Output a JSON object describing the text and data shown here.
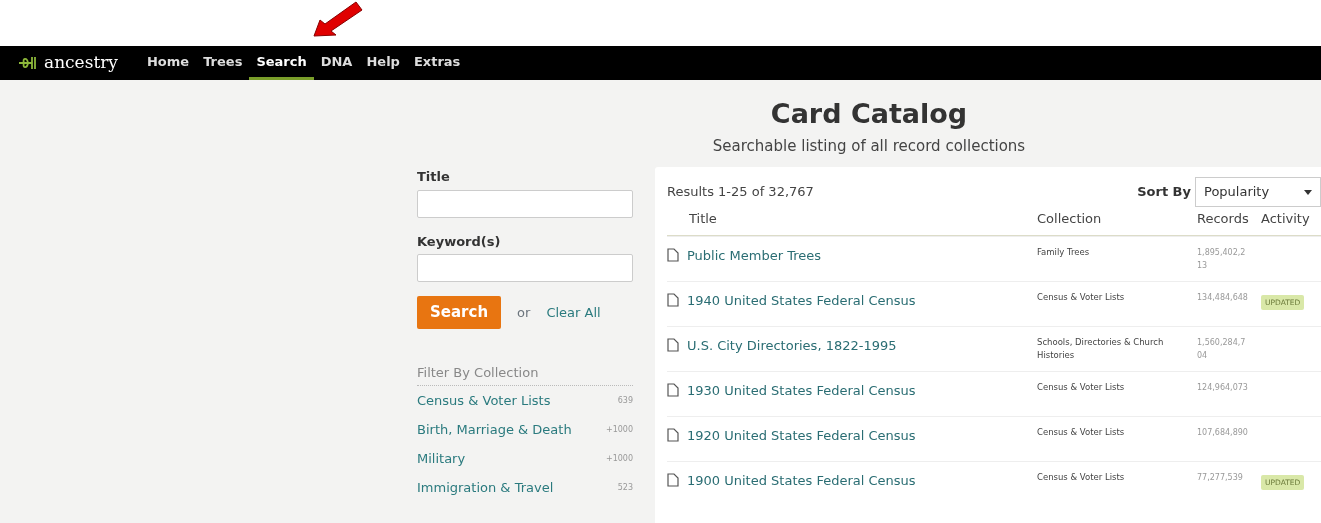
{
  "nav": {
    "logo": "ancestry",
    "items": [
      {
        "label": "Home",
        "selected": false
      },
      {
        "label": "Trees",
        "selected": false
      },
      {
        "label": "Search",
        "selected": true
      },
      {
        "label": "DNA",
        "selected": false
      },
      {
        "label": "Help",
        "selected": false
      },
      {
        "label": "Extras",
        "selected": false
      }
    ]
  },
  "heading": {
    "title": "Card Catalog",
    "subtitle": "Searchable listing of all record collections"
  },
  "form": {
    "fields": [
      {
        "label": "Title"
      },
      {
        "label": "Keyword(s)"
      }
    ],
    "search_button": "Search",
    "or": "or",
    "clear_link": "Clear All",
    "filter_title": "Filter By Collection",
    "filters": [
      {
        "label": "Census & Voter Lists",
        "count": "639"
      },
      {
        "label": "Birth, Marriage & Death",
        "count": "+1000"
      },
      {
        "label": "Military",
        "count": "+1000"
      },
      {
        "label": "Immigration & Travel",
        "count": "523"
      }
    ]
  },
  "results": {
    "summary": "Results 1-25 of 32,767",
    "sort_label": "Sort By",
    "sort_value": "Popularity",
    "columns": [
      "Title",
      "Collection",
      "Records",
      "Activity"
    ],
    "rows": [
      {
        "title": "Public Member Trees",
        "collection": "Family Trees",
        "records": "1,895,402,213"
      },
      {
        "title": "1940 United States Federal Census",
        "collection": "Census & Voter Lists",
        "records": "134,484,648",
        "activity": "UPDATED"
      },
      {
        "title": "U.S. City Directories, 1822-1995",
        "collection": "Schools, Directories & Church Histories",
        "records": "1,560,284,704"
      },
      {
        "title": "1930 United States Federal Census",
        "collection": "Census & Voter Lists",
        "records": "124,964,073"
      },
      {
        "title": "1920 United States Federal Census",
        "collection": "Census & Voter Lists",
        "records": "107,684,890"
      },
      {
        "title": "1900 United States Federal Census",
        "collection": "Census & Voter Lists",
        "records": "77,277,539",
        "activity": "UPDATED"
      }
    ]
  }
}
